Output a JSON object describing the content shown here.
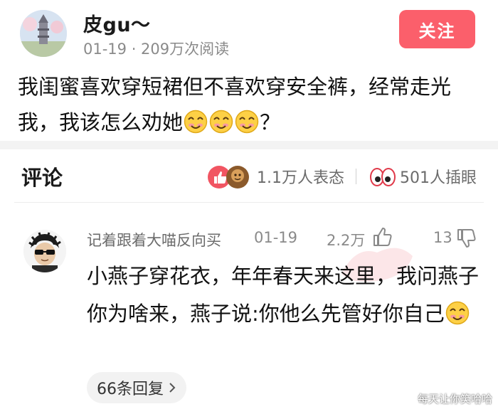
{
  "post": {
    "author_name": "皮gu～",
    "meta": "01-19 · 209万次阅读",
    "follow_label": "关注",
    "body_text": "我闺蜜喜欢穿短裙但不喜欢穿安全裤，经常走光我，我该怎么劝她",
    "body_suffix": "？"
  },
  "comments_header": {
    "title": "评论",
    "reactions_count": "1.1万人表态",
    "eyes_count": "501人插眼"
  },
  "comment": {
    "author": "记着跟着大喵反向买",
    "date": "01-19",
    "likes": "2.2万",
    "dislikes": "13",
    "text": "小燕子穿花衣，年年春天来这里，我问燕子你为啥来，燕子说:你他么先管好你自己",
    "replies_label": "66条回复"
  },
  "watermark": "每天让你笑哈哈",
  "colors": {
    "follow_bg": "#fb5f6b",
    "emoji_face": "#fdd046",
    "reaction_red": "#f15562",
    "reaction_brown": "#8b5a2b"
  },
  "icons": {
    "smile": "smile-emoji-icon",
    "like": "thumbs-up-icon",
    "dislike": "thumbs-down-icon",
    "eyes": "eyes-icon",
    "chevron": "chevron-right-icon"
  }
}
